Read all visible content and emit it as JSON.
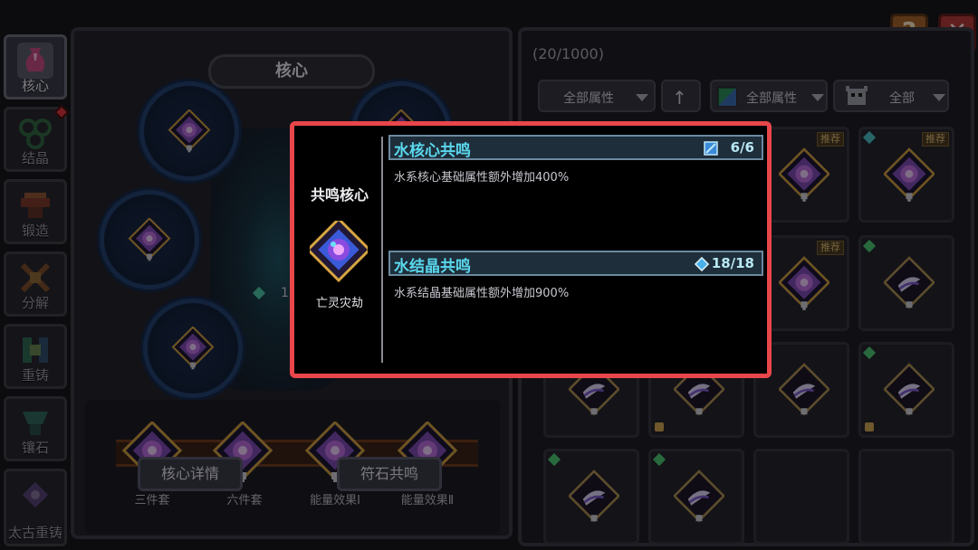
{
  "sidebar": {
    "tabs": [
      {
        "label": "核心",
        "icon": "vase-icon",
        "active": true,
        "color": "#c04a80"
      },
      {
        "label": "结晶",
        "icon": "crystal-icon",
        "active": false,
        "color": "#3a9a50",
        "badge": true
      },
      {
        "label": "锻造",
        "icon": "anvil-icon",
        "active": false,
        "color": "#c04a2a"
      },
      {
        "label": "分解",
        "icon": "disassemble-icon",
        "active": false,
        "color": "#c06a2a"
      },
      {
        "label": "重铸",
        "icon": "recast-icon",
        "active": false,
        "color": "#3aa070"
      },
      {
        "label": "镶石",
        "icon": "inlay-icon",
        "active": false,
        "color": "#3a9a80"
      },
      {
        "label": "太古重铸",
        "icon": "ancient-recast-icon",
        "active": false,
        "color": "#7a5ab0"
      }
    ]
  },
  "core_panel": {
    "title": "核心",
    "partial_count": "13",
    "sets": [
      "三件套",
      "六件套",
      "能量效果Ⅰ",
      "能量效果Ⅱ"
    ],
    "detail_button": "核心详情",
    "rune_button": "符石共鸣"
  },
  "top_buttons": {
    "help": "?",
    "close": "✕"
  },
  "inventory": {
    "count": "(20/1000)",
    "filter_attr": "全部属性",
    "filter_attr2": "全部属性",
    "filter_type": "全部",
    "recommend_tag": "推荐"
  },
  "popup": {
    "heading": "共鸣核心",
    "item_name": "亡灵灾劫",
    "resonances": [
      {
        "title": "水核心共鸣",
        "count": "6/6",
        "desc": "水系核心基础属性额外增加400%",
        "icon": "water-core-icon"
      },
      {
        "title": "水结晶共鸣",
        "count": "18/18",
        "desc": "水系结晶基础属性额外增加900%",
        "icon": "water-crystal-icon"
      }
    ]
  },
  "colors": {
    "popup_border": "#e8464a",
    "resonance_title": "#5ad8ee",
    "help_button": "#a0622a",
    "close_button": "#b03a38"
  }
}
